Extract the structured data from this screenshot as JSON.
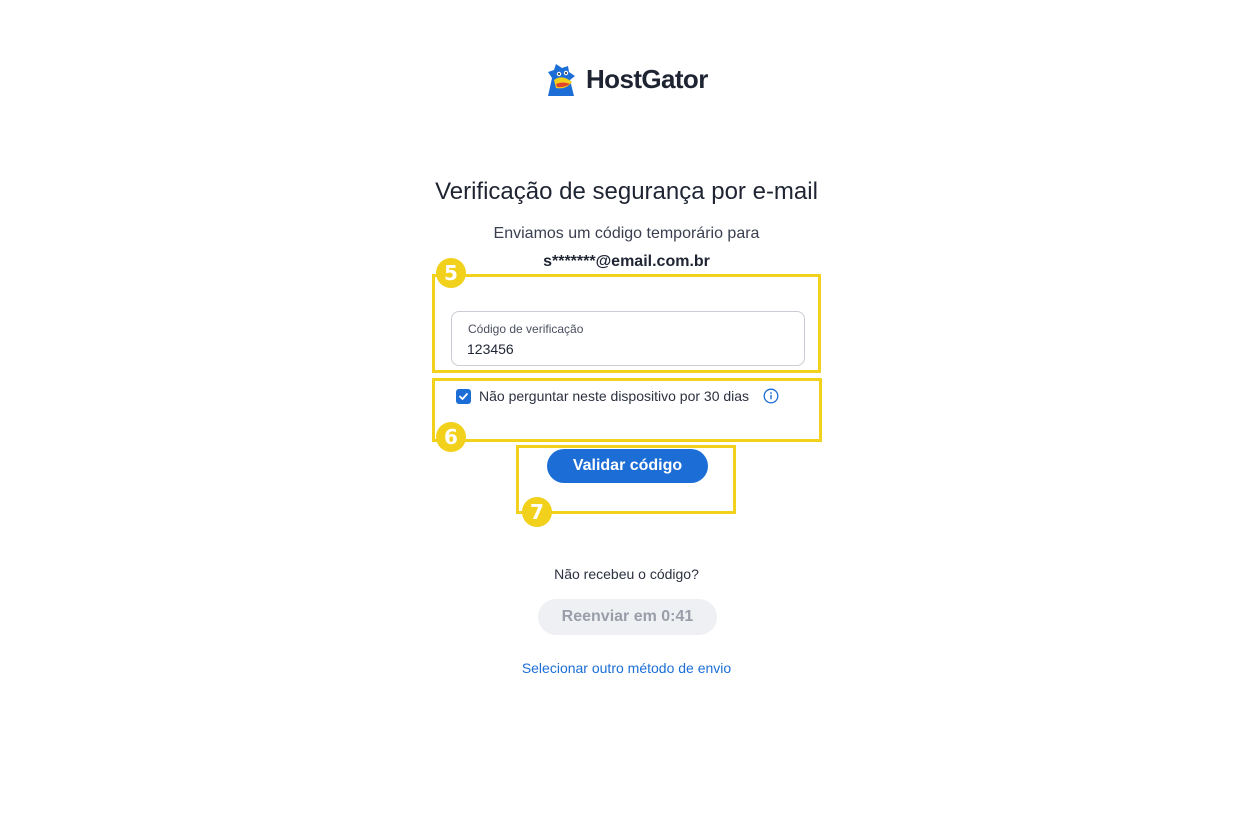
{
  "brand": {
    "name": "HostGator",
    "logo_icon": "gator-mascot-icon",
    "colors": {
      "primary": "#1c6ed6",
      "annotation": "#f2d11c",
      "text": "#1f2433"
    }
  },
  "main": {
    "title": "Verificação de segurança por e-mail",
    "subtitle": "Enviamos um código temporário para",
    "email": "s*******@email.com.br"
  },
  "form": {
    "code_label": "Código de verificação",
    "code_value": "123456",
    "remember_label": "Não perguntar neste dispositivo por 30 dias",
    "remember_checked": true,
    "submit_label": "Validar código"
  },
  "resend": {
    "question": "Não recebeu o código?",
    "button_label": "Reenviar em 0:41",
    "other_method_label": "Selecionar outro método de envio"
  },
  "annotations": [
    {
      "number": "5"
    },
    {
      "number": "6"
    },
    {
      "number": "7"
    }
  ]
}
